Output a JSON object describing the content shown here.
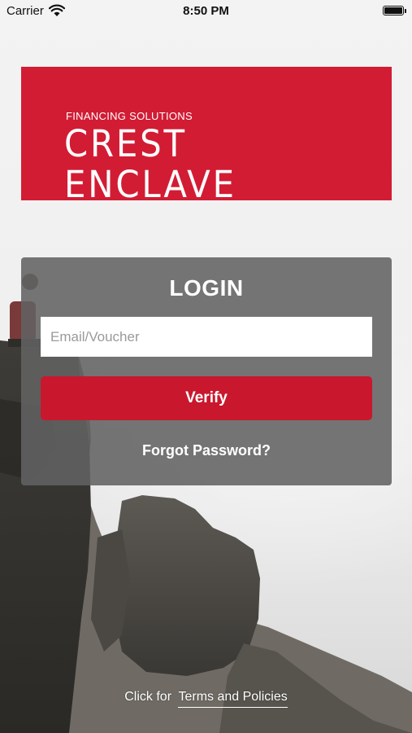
{
  "status_bar": {
    "carrier": "Carrier",
    "time": "8:50 PM",
    "icons": [
      "wifi-icon",
      "battery-icon"
    ]
  },
  "brand": {
    "tagline": "FINANCING SOLUTIONS",
    "name": "CREST ENCLAVE",
    "color": "#d21c34"
  },
  "login": {
    "title": "LOGIN",
    "email_placeholder": "Email/Voucher",
    "email_value": "",
    "verify_label": "Verify",
    "forgot_label": "Forgot Password?"
  },
  "footer": {
    "prefix": "Click for",
    "terms_label": "Terms and Policies"
  },
  "colors": {
    "accent": "#c9182d",
    "card": "#626262"
  }
}
